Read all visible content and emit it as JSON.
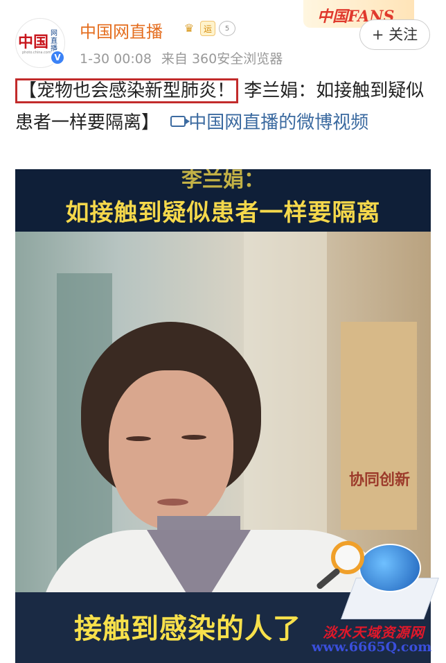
{
  "header": {
    "avatar_logo": "中国",
    "avatar_sub": "网直播",
    "avatar_url": "photo.china.com.cn",
    "verified_mark": "V",
    "account_name": "中国网直播",
    "badges": {
      "crown": "♛",
      "yun": "运",
      "level": "5"
    },
    "timestamp": "1-30 00:08",
    "source": "来自 360安全浏览器",
    "fans_banner": "中国FANS",
    "follow_label": "+ 关注"
  },
  "post": {
    "highlight_text": "【宠物也会感染新型肺炎！",
    "body_text": " 李兰娟：如接触到疑似患者一样要隔离】",
    "link_text": "中国网直播的微博视频"
  },
  "video": {
    "caption_top_1": "李兰娟：",
    "caption_top_2": "如接触到疑似患者一样要隔离",
    "sign_text": "协同创新",
    "caption_bottom": "接触到感染的人了"
  },
  "watermark": {
    "line1": "淡水天域资源网",
    "line2": "www.6665Q.com"
  },
  "colors": {
    "accent_orange": "#e46d1e",
    "link_blue": "#3b6aa0",
    "highlight_red": "#c22b2b",
    "caption_yellow": "#f5d84b"
  }
}
